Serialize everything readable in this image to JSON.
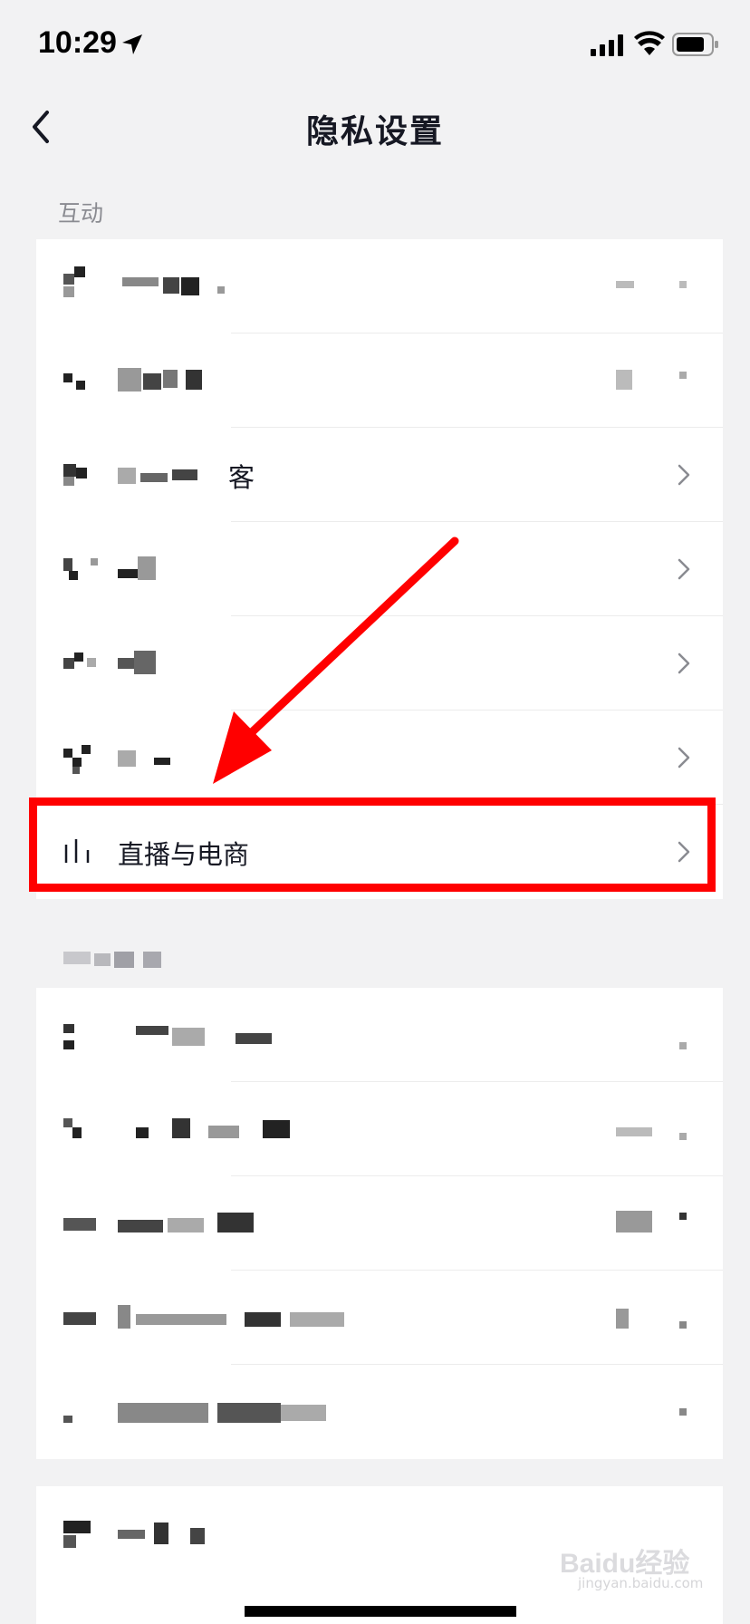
{
  "status_bar": {
    "time": "10:29"
  },
  "header": {
    "title": "隐私设置"
  },
  "sections": {
    "interaction": {
      "label": "互动",
      "visible_rows": {
        "row3_suffix": "客",
        "live_commerce": "直播与电商"
      }
    }
  },
  "watermark": {
    "brand": "Baidu经验",
    "sub": "jingyan.baidu.com"
  },
  "colors": {
    "highlight": "#ff0000",
    "background": "#f2f2f3",
    "card": "#ffffff",
    "text": "#161823"
  }
}
